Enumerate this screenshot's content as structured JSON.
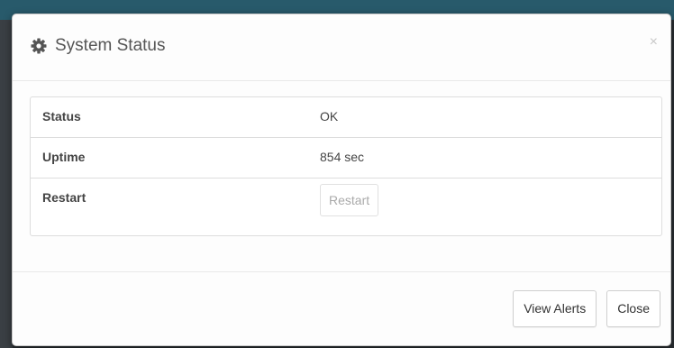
{
  "modal": {
    "title": "System Status",
    "title_icon": "gear-icon",
    "close_glyph": "×"
  },
  "status_table": {
    "rows": [
      {
        "label": "Status",
        "value": "OK"
      },
      {
        "label": "Uptime",
        "value": "854 sec"
      },
      {
        "label": "Restart",
        "button_label": "Restart",
        "button_disabled": true
      }
    ]
  },
  "footer": {
    "view_alerts_label": "View Alerts",
    "close_label": "Close"
  },
  "colors": {
    "backdrop_top": "#285a6b",
    "text": "#444444",
    "border": "#dddddd"
  }
}
